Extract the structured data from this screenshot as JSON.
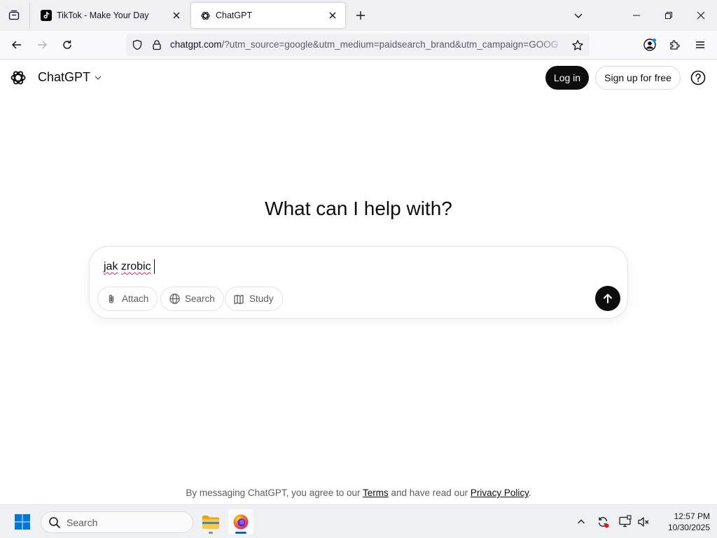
{
  "browser": {
    "tabs": [
      {
        "title": "TikTok - Make Your Day",
        "active": false,
        "favicon": "tiktok-icon"
      },
      {
        "title": "ChatGPT",
        "active": true,
        "favicon": "openai-icon"
      }
    ],
    "url": {
      "host": "chatgpt.com",
      "rest": "/?utm_source=google&utm_medium=paidsearch_brand&utm_campaign=GOOG"
    }
  },
  "chatgpt": {
    "brand": "ChatGPT",
    "login_label": "Log in",
    "signup_label": "Sign up for free",
    "headline": "What can I help with?",
    "composer": {
      "words": [
        "jak",
        "zrobic"
      ],
      "chips": [
        {
          "label": "Attach",
          "icon": "paperclip-icon"
        },
        {
          "label": "Search",
          "icon": "globe-icon"
        },
        {
          "label": "Study",
          "icon": "book-icon"
        }
      ]
    },
    "disclaimer": {
      "prefix": "By messaging ChatGPT, you agree to our ",
      "terms": "Terms",
      "middle": " and have read our ",
      "privacy": "Privacy Policy",
      "suffix": "."
    }
  },
  "taskbar": {
    "search_label": "Search",
    "time": "12:57 PM",
    "date": "10/30/2025"
  },
  "colors": {
    "accent_dark": "#0d0d0d",
    "spellcheck": "#e0245e",
    "taskbar_active": "#0067c0"
  }
}
